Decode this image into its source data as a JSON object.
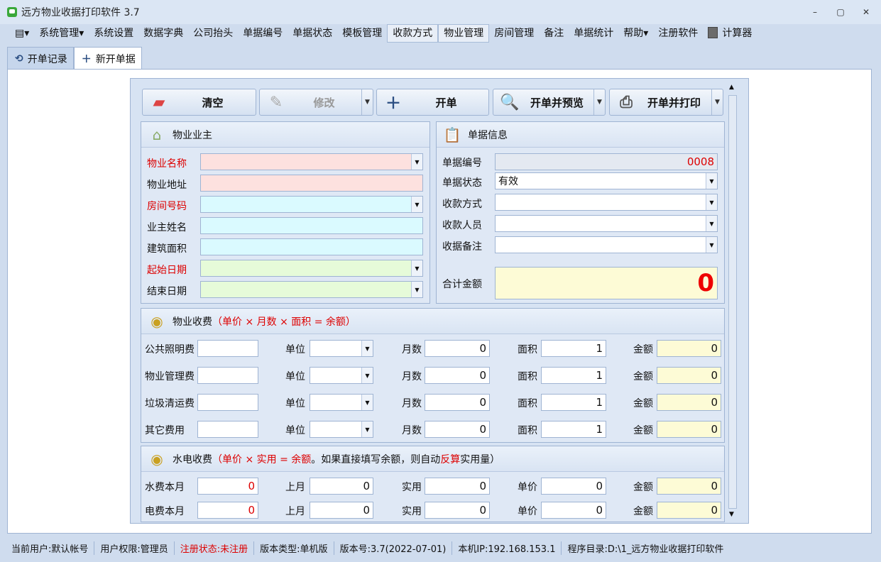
{
  "window": {
    "title": "远方物业收据打印软件 3.7",
    "minimize": "–",
    "maximize": "▢",
    "close": "✕"
  },
  "menu": {
    "items": [
      "系统管理",
      "系统设置",
      "数据字典",
      "公司抬头",
      "单据编号",
      "单据状态",
      "模板管理",
      "收款方式",
      "物业管理",
      "房间管理",
      "备注",
      "单据统计",
      "帮助",
      "注册软件",
      "计算器"
    ]
  },
  "tabs": [
    {
      "label": "开单记录"
    },
    {
      "label": "新开单据"
    }
  ],
  "toolbar": {
    "clear": "清空",
    "edit": "修改",
    "create": "开单",
    "create_preview": "开单并预览",
    "create_print": "开单并打印"
  },
  "owner": {
    "title": "物业业主",
    "fields": [
      {
        "label": "物业名称",
        "value": ""
      },
      {
        "label": "物业地址",
        "value": ""
      },
      {
        "label": "房间号码",
        "value": ""
      },
      {
        "label": "业主姓名",
        "value": ""
      },
      {
        "label": "建筑面积",
        "value": ""
      },
      {
        "label": "起始日期",
        "value": ""
      },
      {
        "label": "结束日期",
        "value": ""
      }
    ]
  },
  "receipt": {
    "title": "单据信息",
    "number_label": "单据编号",
    "number": "0008",
    "status_label": "单据状态",
    "status": "有效",
    "method_label": "收款方式",
    "method": "",
    "payee_label": "收款人员",
    "payee": "",
    "note_label": "收据备注",
    "note": "",
    "total_label": "合计金额",
    "total": "0"
  },
  "property_fee": {
    "title": "物业收费",
    "formula": "（单价 × 月数 × 面积 = 余额）",
    "col_unit": "单位",
    "col_months": "月数",
    "col_area": "面积",
    "col_amount": "金额",
    "rows": [
      {
        "label": "公共照明费",
        "months": "0",
        "area": "1",
        "amount": "0"
      },
      {
        "label": "物业管理费",
        "months": "0",
        "area": "1",
        "amount": "0"
      },
      {
        "label": "垃圾清运费",
        "months": "0",
        "area": "1",
        "amount": "0"
      },
      {
        "label": "其它费用",
        "months": "0",
        "area": "1",
        "amount": "0"
      }
    ]
  },
  "utility_fee": {
    "title": "水电收费",
    "formula_a": "（单价 × 实用 = 余额",
    "formula_b": "。如果直接填写余额，则自动",
    "formula_c": "反算",
    "formula_d": "实用量）",
    "col_last": "上月",
    "col_used": "实用",
    "col_price": "单价",
    "col_amount": "金额",
    "rows": [
      {
        "label": "水费本月",
        "current": "0",
        "last": "0",
        "used": "0",
        "price": "0",
        "amount": "0"
      },
      {
        "label": "电费本月",
        "current": "0",
        "last": "0",
        "used": "0",
        "price": "0",
        "amount": "0"
      }
    ]
  },
  "status": {
    "user": "当前用户:默认帐号",
    "role": "用户权限:管理员",
    "reg": "注册状态:未注册",
    "type": "版本类型:单机版",
    "version": "版本号:3.7(2022-07-01)",
    "ip": "本机IP:192.168.153.1",
    "dir": "程序目录:D:\\1_远方物业收据打印软件"
  }
}
